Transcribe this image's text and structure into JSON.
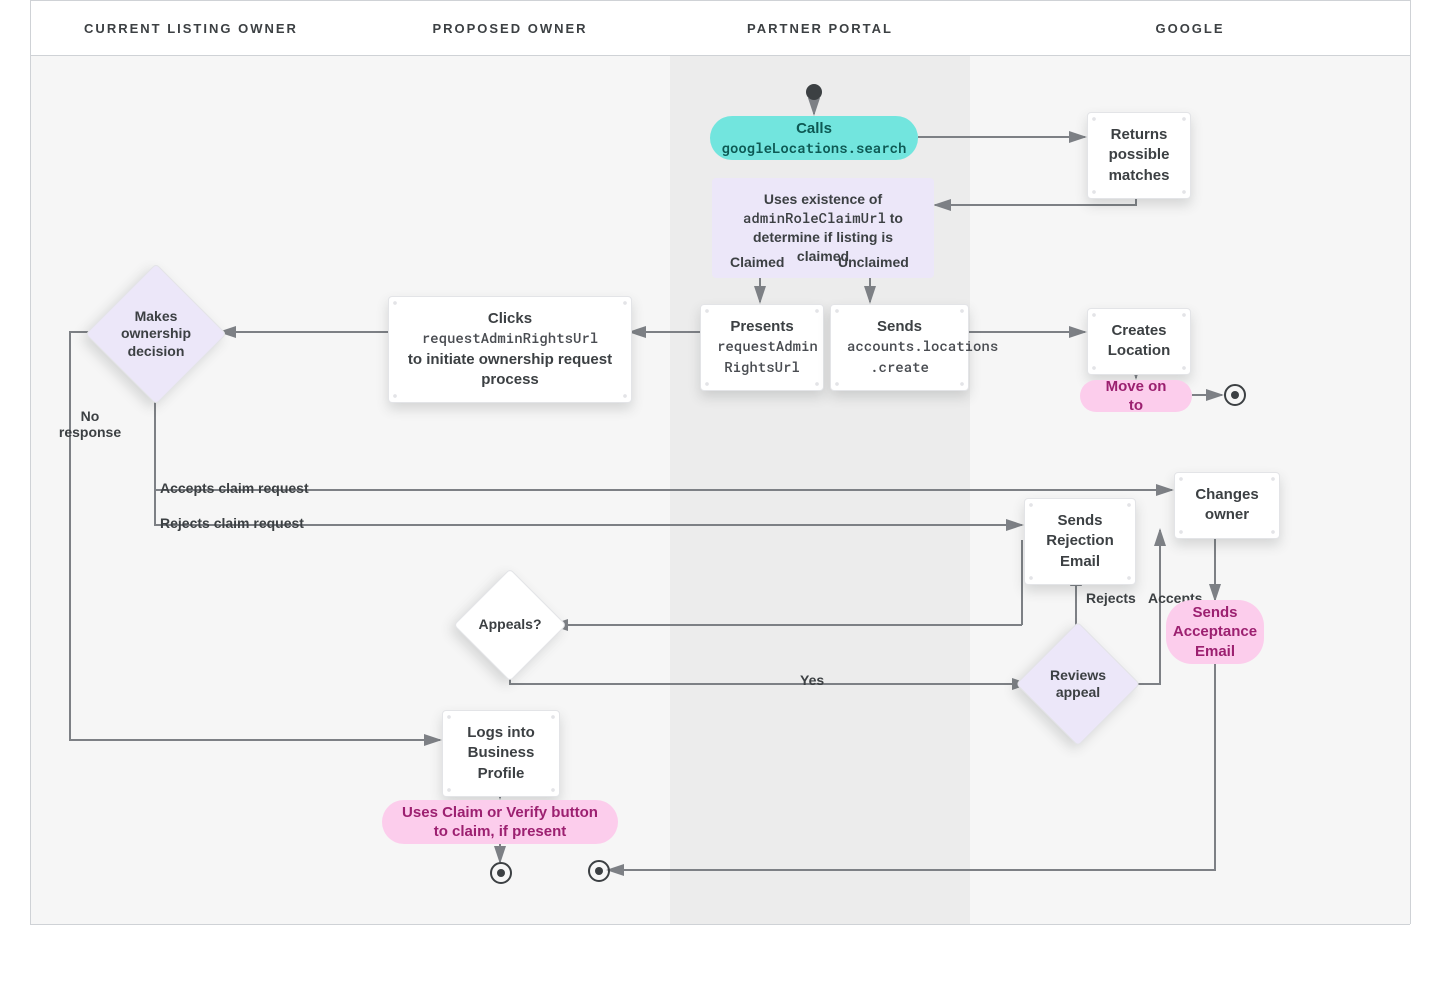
{
  "lanes": {
    "currentOwner": "CURRENT LISTING OWNER",
    "proposedOwner": "PROPOSED OWNER",
    "partnerPortal": "PARTNER PORTAL",
    "google": "GOOGLE"
  },
  "nodes": {
    "calls": {
      "line1": "Calls",
      "line2": "googleLocations.search"
    },
    "returnsMatches": "Returns possible matches",
    "usesExistence": {
      "line1": "Uses existence of",
      "line2": "adminRoleClaimUrl",
      "line3": "to determine if listing is claimed"
    },
    "claimed": "Claimed",
    "unclaimed": "Unclaimed",
    "presents": {
      "line1": "Presents",
      "line2": "requestAdmin",
      "line3": "RightsUrl"
    },
    "sends": {
      "line1": "Sends",
      "line2": "accounts.locations",
      "line3": ".create"
    },
    "createsLocation": "Creates Location",
    "moveOn": "Move on to",
    "clicks": {
      "line1": "Clicks",
      "line2": "requestAdminRightsUrl",
      "line3": "to initiate ownership request process"
    },
    "makesDecision": "Makes ownership decision",
    "noResponse": "No response",
    "acceptsClaim": "Accepts claim request",
    "rejectsClaim": "Rejects claim request",
    "changesOwner": "Changes owner",
    "sendsRejection": "Sends Rejection Email",
    "appeals": "Appeals?",
    "yes": "Yes",
    "reviewsAppeal": "Reviews appeal",
    "rejects": "Rejects",
    "accepts": "Accepts",
    "sendsAcceptance": "Sends Acceptance Email",
    "logsInto": "Logs into Business Profile",
    "usesClaim": "Uses Claim or Verify button to claim, if present"
  }
}
